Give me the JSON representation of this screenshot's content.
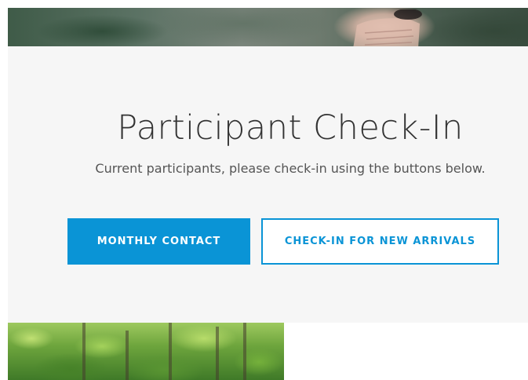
{
  "checkin": {
    "title": "Participant Check-In",
    "subtitle": "Current participants, please check-in using the buttons below.",
    "buttons": {
      "monthly_contact": "MONTHLY CONTACT",
      "new_arrivals": "CHECK-IN FOR NEW ARRIVALS"
    }
  },
  "colors": {
    "accent": "#0a94d6",
    "card_background": "#f6f6f6",
    "title_text": "#333333",
    "subtitle_text": "#555555"
  },
  "images": {
    "top": "hero-photo-hand-forest",
    "bottom": "forest-trees-photo"
  }
}
